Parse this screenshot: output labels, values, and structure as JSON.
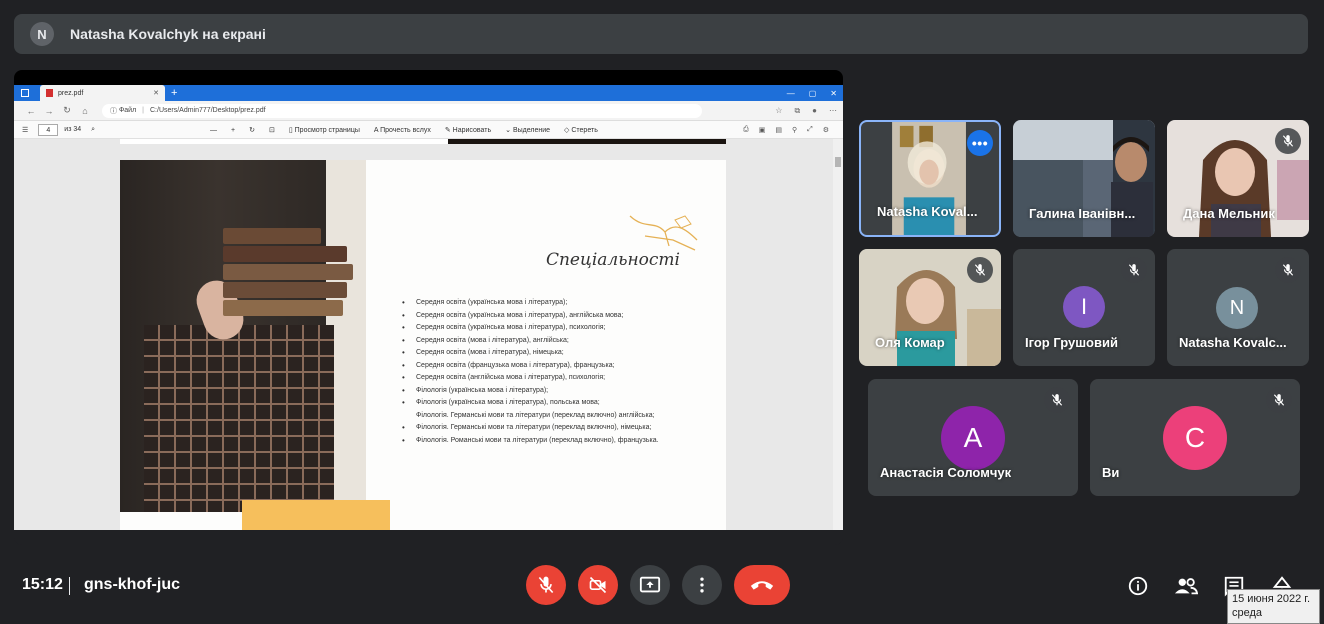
{
  "presenter_bar": {
    "avatar_letter": "N",
    "title": "Natasha Kovalchyk на екрані"
  },
  "shared_screen": {
    "browser": {
      "tab_title": "prez.pdf",
      "address_label": "Файл",
      "address_url": "C:/Users/Admin777/Desktop/prez.pdf"
    },
    "pdf_toolbar": {
      "page_current": "4",
      "page_total": "из 34",
      "view_label": "Просмотр страницы",
      "read_aloud_label": "Прочесть вслух",
      "draw_label": "Нарисовать",
      "highlight_label": "Выделение",
      "erase_label": "Стереть"
    },
    "slide": {
      "title": "Спеціальності",
      "items": [
        {
          "text": "Середня освіта (українська мова і література);",
          "bullet": true
        },
        {
          "text": "Середня освіта (українська мова і література), англійська мова;",
          "bullet": true
        },
        {
          "text": "Середня освіта (українська мова і література), психологія;",
          "bullet": true
        },
        {
          "text": "Середня освіта (мова і література), англійська;",
          "bullet": true
        },
        {
          "text": "Середня освіта (мова і література), німецька;",
          "bullet": true
        },
        {
          "text": "Середня освіта (французька мова і література), французька;",
          "bullet": true
        },
        {
          "text": "Середня освіта (англійська мова і література), психологія;",
          "bullet": true
        },
        {
          "text": "Філологія (українська мова і література);",
          "bullet": true
        },
        {
          "text": "Філологія (українська мова і література), польська мова;",
          "bullet": true
        },
        {
          "text": "Філологія. Германські мови та літератури (переклад включно) англійська;",
          "bullet": false
        },
        {
          "text": "Філологія. Германські мови та літератури (переклад включно), німецька;",
          "bullet": true
        },
        {
          "text": "Філологія. Романські мови та літератури (переклад включно), французька.",
          "bullet": true
        }
      ]
    }
  },
  "participants": [
    {
      "name": "Natasha Koval...",
      "muted": false,
      "has_video": true,
      "active": true
    },
    {
      "name": "Галина Іванівн...",
      "muted": false,
      "has_video": true
    },
    {
      "name": "Дана Мельник",
      "muted": true,
      "has_video": true
    },
    {
      "name": "Оля Комар",
      "muted": true,
      "has_video": true
    },
    {
      "name": "Ігор Грушовий",
      "muted": true,
      "has_video": false,
      "letter": "І",
      "color": "#7e57c2"
    },
    {
      "name": "Natasha Kovalc...",
      "muted": true,
      "has_video": false,
      "letter": "N",
      "color": "#78909c"
    },
    {
      "name": "Анастасія Соломчук",
      "muted": true,
      "has_video": false,
      "letter": "A",
      "color": "#8e24aa"
    },
    {
      "name": "Ви",
      "muted": true,
      "has_video": false,
      "letter": "C",
      "color": "#ec407a"
    }
  ],
  "bottom_bar": {
    "time": "15:12",
    "meeting_code": "gns-khof-juc",
    "controls": [
      "mic-off",
      "camera-off",
      "present-screen",
      "more-options",
      "leave-call"
    ],
    "right_controls": [
      "info",
      "people",
      "chat",
      "activities"
    ]
  },
  "tooltip": {
    "date": "15 июня 2022 г.",
    "weekday": "среда"
  },
  "colors": {
    "background": "#202124",
    "tile": "#3c4043",
    "red_control": "#ea4335",
    "accent_blue": "#1a73e8",
    "active_border": "#8ab4f8"
  }
}
